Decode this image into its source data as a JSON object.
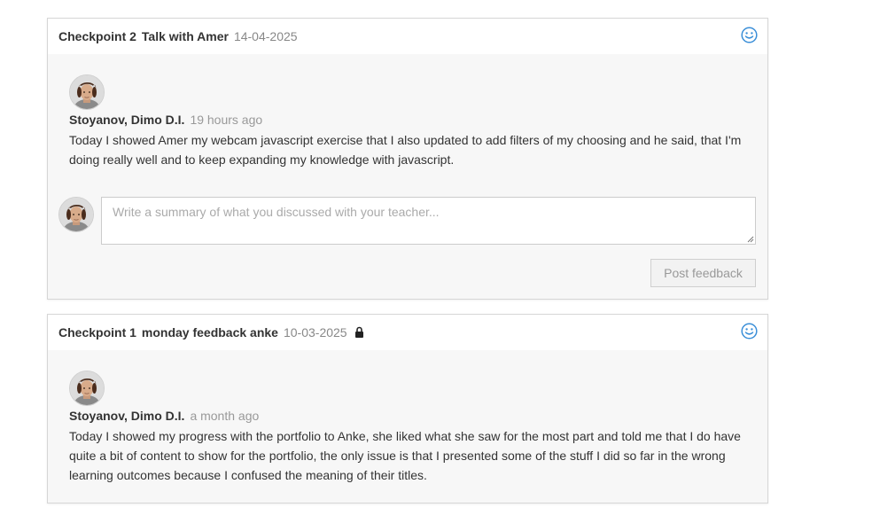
{
  "colors": {
    "accent": "#3b8fd8",
    "border": "#d6d6d6",
    "card_bg": "#f7f7f7",
    "header_bg": "#ffffff"
  },
  "checkpoints": [
    {
      "label": "Checkpoint 2",
      "name": "Talk with Amer",
      "date": "14-04-2025",
      "locked": false,
      "status_icon": "smiley-icon",
      "feedback": {
        "author": "Stoyanov, Dimo D.I.",
        "time_ago": "19 hours ago",
        "text": "Today I showed Amer my webcam javascript exercise that I also updated to add filters of my choosing and he said, that I'm doing really well and to keep expanding my knowledge with javascript."
      },
      "reply": {
        "placeholder": "Write a summary of what you discussed with your teacher...",
        "value": "",
        "post_label": "Post feedback"
      }
    },
    {
      "label": "Checkpoint 1",
      "name": "monday feedback anke",
      "date": "10-03-2025",
      "locked": true,
      "status_icon": "smiley-icon",
      "feedback": {
        "author": "Stoyanov, Dimo D.I.",
        "time_ago": "a month ago",
        "text": "Today I showed my progress with the portfolio to Anke, she liked what she saw for the most part and told me that I do have quite a bit of content to show for the portfolio, the only issue is that I presented some of the stuff I did so far in the wrong learning outcomes because I confused the meaning of their titles."
      }
    }
  ]
}
